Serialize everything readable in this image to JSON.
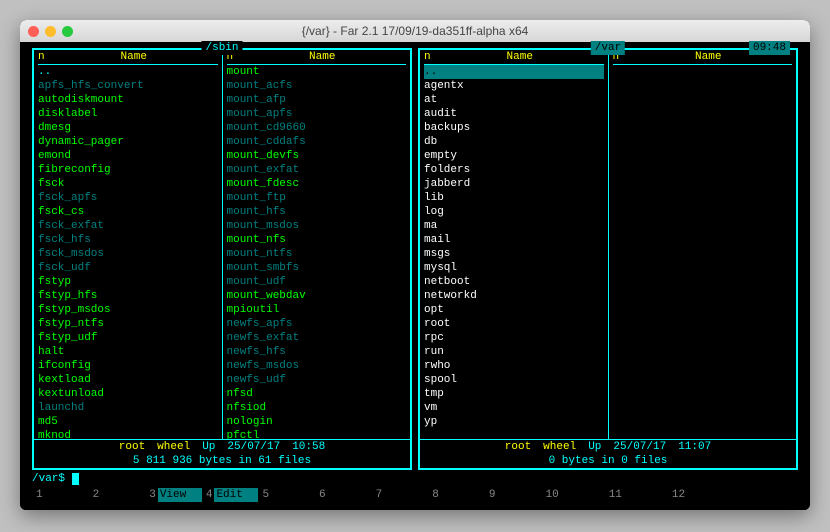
{
  "window_title": "{/var} - Far 2.1 17/09/19-da351ff-alpha x64",
  "clock": "09:48",
  "prompt": "/var$",
  "left": {
    "path": "/sbin",
    "head_n": "n",
    "head_name": "Name",
    "foot1": {
      "owner": "root",
      "group": "wheel",
      "kind": "Up",
      "date": "25/07/17",
      "time": "10:58"
    },
    "foot2": "5 811 936 bytes in 61 files",
    "cols": [
      [
        {
          "t": "..",
          "c": "updir"
        },
        {
          "t": "apfs_hfs_convert",
          "c": "sym"
        },
        {
          "t": "autodiskmount",
          "c": "exec"
        },
        {
          "t": "disklabel",
          "c": "exec"
        },
        {
          "t": "dmesg",
          "c": "exec"
        },
        {
          "t": "dynamic_pager",
          "c": "exec"
        },
        {
          "t": "emond",
          "c": "exec"
        },
        {
          "t": "fibreconfig",
          "c": "exec"
        },
        {
          "t": "fsck",
          "c": "exec"
        },
        {
          "t": "fsck_apfs",
          "c": "sym"
        },
        {
          "t": "fsck_cs",
          "c": "exec"
        },
        {
          "t": "fsck_exfat",
          "c": "sym"
        },
        {
          "t": "fsck_hfs",
          "c": "sym"
        },
        {
          "t": "fsck_msdos",
          "c": "sym"
        },
        {
          "t": "fsck_udf",
          "c": "sym"
        },
        {
          "t": "fstyp",
          "c": "exec"
        },
        {
          "t": "fstyp_hfs",
          "c": "exec"
        },
        {
          "t": "fstyp_msdos",
          "c": "exec"
        },
        {
          "t": "fstyp_ntfs",
          "c": "exec"
        },
        {
          "t": "fstyp_udf",
          "c": "exec"
        },
        {
          "t": "halt",
          "c": "exec"
        },
        {
          "t": "ifconfig",
          "c": "exec"
        },
        {
          "t": "kextload",
          "c": "exec"
        },
        {
          "t": "kextunload",
          "c": "exec"
        },
        {
          "t": "launchd",
          "c": "sym"
        },
        {
          "t": "md5",
          "c": "exec"
        },
        {
          "t": "mknod",
          "c": "exec"
        }
      ],
      [
        {
          "t": "mount",
          "c": "exec"
        },
        {
          "t": "mount_acfs",
          "c": "sym"
        },
        {
          "t": "mount_afp",
          "c": "sym"
        },
        {
          "t": "mount_apfs",
          "c": "sym"
        },
        {
          "t": "mount_cd9660",
          "c": "sym"
        },
        {
          "t": "mount_cddafs",
          "c": "sym"
        },
        {
          "t": "mount_devfs",
          "c": "exec"
        },
        {
          "t": "mount_exfat",
          "c": "sym"
        },
        {
          "t": "mount_fdesc",
          "c": "exec"
        },
        {
          "t": "mount_ftp",
          "c": "sym"
        },
        {
          "t": "mount_hfs",
          "c": "sym"
        },
        {
          "t": "mount_msdos",
          "c": "sym"
        },
        {
          "t": "mount_nfs",
          "c": "exec"
        },
        {
          "t": "mount_ntfs",
          "c": "sym"
        },
        {
          "t": "mount_smbfs",
          "c": "sym"
        },
        {
          "t": "mount_udf",
          "c": "sym"
        },
        {
          "t": "mount_webdav",
          "c": "exec"
        },
        {
          "t": "mpioutil",
          "c": "exec"
        },
        {
          "t": "newfs_apfs",
          "c": "sym"
        },
        {
          "t": "newfs_exfat",
          "c": "sym"
        },
        {
          "t": "newfs_hfs",
          "c": "sym"
        },
        {
          "t": "newfs_msdos",
          "c": "sym"
        },
        {
          "t": "newfs_udf",
          "c": "sym"
        },
        {
          "t": "nfsd",
          "c": "exec"
        },
        {
          "t": "nfsiod",
          "c": "exec"
        },
        {
          "t": "nologin",
          "c": "exec"
        },
        {
          "t": "pfctl",
          "c": "exec"
        }
      ]
    ]
  },
  "right": {
    "path": "/var",
    "head_n": "n",
    "head_name": "Name",
    "foot1": {
      "owner": "root",
      "group": "wheel",
      "kind": "Up",
      "date": "25/07/17",
      "time": "11:07"
    },
    "foot2": "0 bytes in 0 files",
    "cols": [
      [
        {
          "t": "..",
          "c": "updir",
          "sel": true
        },
        {
          "t": "agentx",
          "c": "dir"
        },
        {
          "t": "at",
          "c": "dir"
        },
        {
          "t": "audit",
          "c": "dir"
        },
        {
          "t": "backups",
          "c": "dir"
        },
        {
          "t": "db",
          "c": "dir"
        },
        {
          "t": "empty",
          "c": "dir"
        },
        {
          "t": "folders",
          "c": "dir"
        },
        {
          "t": "jabberd",
          "c": "dir"
        },
        {
          "t": "lib",
          "c": "dir"
        },
        {
          "t": "log",
          "c": "dir"
        },
        {
          "t": "ma",
          "c": "dir"
        },
        {
          "t": "mail",
          "c": "dir"
        },
        {
          "t": "msgs",
          "c": "dir"
        },
        {
          "t": "mysql",
          "c": "dir"
        },
        {
          "t": "netboot",
          "c": "dir"
        },
        {
          "t": "networkd",
          "c": "dir"
        },
        {
          "t": "opt",
          "c": "dir"
        },
        {
          "t": "root",
          "c": "dir"
        },
        {
          "t": "rpc",
          "c": "dir"
        },
        {
          "t": "run",
          "c": "dir"
        },
        {
          "t": "rwho",
          "c": "dir"
        },
        {
          "t": "spool",
          "c": "dir"
        },
        {
          "t": "tmp",
          "c": "dir"
        },
        {
          "t": "vm",
          "c": "dir"
        },
        {
          "t": "yp",
          "c": "dir"
        }
      ],
      []
    ]
  },
  "fkeys": [
    {
      "n": "1",
      "l": ""
    },
    {
      "n": "2",
      "l": ""
    },
    {
      "n": "3",
      "l": "View"
    },
    {
      "n": "4",
      "l": "Edit"
    },
    {
      "n": "5",
      "l": ""
    },
    {
      "n": "6",
      "l": ""
    },
    {
      "n": "7",
      "l": ""
    },
    {
      "n": "8",
      "l": ""
    },
    {
      "n": "9",
      "l": ""
    },
    {
      "n": "10",
      "l": ""
    },
    {
      "n": "11",
      "l": ""
    },
    {
      "n": "12",
      "l": ""
    }
  ]
}
